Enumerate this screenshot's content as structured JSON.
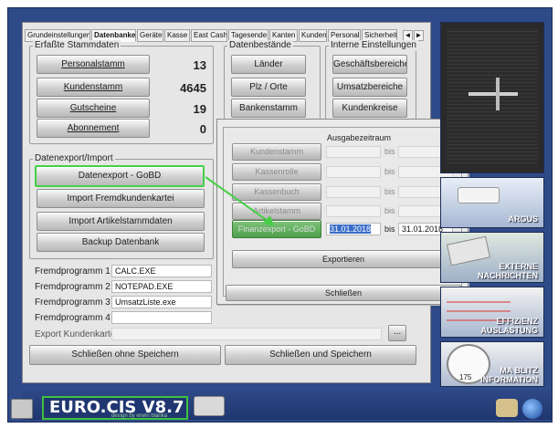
{
  "tabs": [
    "Grundeinstellungen",
    "Datenbanken",
    "Geräte",
    "Kasse",
    "East Cash",
    "Tagesende",
    "Kanten",
    "Kunden",
    "Personal",
    "Sicherheit"
  ],
  "tab_arrows": [
    "◄",
    "►"
  ],
  "stammdaten": {
    "title": "Erfaßte Stammdaten",
    "rows": [
      {
        "label": "Personalstamm",
        "count": "13"
      },
      {
        "label": "Kundenstamm",
        "count": "4645"
      },
      {
        "label": "Gutscheine",
        "count": "19"
      },
      {
        "label": "Abonnement",
        "count": "0"
      }
    ]
  },
  "datenbestand": {
    "title": "Datenbestände",
    "buttons": [
      "Länder",
      "Plz / Orte",
      "Bankenstamm"
    ]
  },
  "intern": {
    "title": "Interne Einstellungen",
    "buttons": [
      "Geschäftsbereiche",
      "Umsatzbereiche",
      "Kundenkreise"
    ]
  },
  "export": {
    "title": "Datenexport/Import",
    "buttons": [
      "Datenexport - GoBD",
      "Import Fremdkundenkartei",
      "Import Artikelstammdaten",
      "Backup Datenbank"
    ]
  },
  "fremd": [
    {
      "label": "Fremdprogramm 1",
      "value": "CALC.EXE"
    },
    {
      "label": "Fremdprogramm 2",
      "value": "NOTEPAD.EXE"
    },
    {
      "label": "Fremdprogramm 3",
      "value": "UmsatzListe.exe"
    },
    {
      "label": "Fremdprogramm 4",
      "value": ""
    }
  ],
  "export_kundenkartei": {
    "label": "Export Kundenkartei",
    "value": "",
    "browse": "..."
  },
  "footer_buttons": {
    "close_no_save": "Schließen ohne Speichern",
    "close_save": "Schließen und Speichern"
  },
  "modal": {
    "period_label": "Ausgabezeitraum",
    "rows": [
      {
        "label": "Kundenstamm",
        "from": "",
        "to_label": "bis",
        "to": ""
      },
      {
        "label": "Kassenrolle",
        "from": "",
        "to_label": "bis",
        "to": ""
      },
      {
        "label": "Kassenbuch",
        "from": "",
        "to_label": "bis",
        "to": ""
      },
      {
        "label": "Artikelstamm",
        "from": "",
        "to_label": "bis",
        "to": ""
      },
      {
        "label": "Finanzexport - GoBD",
        "from": "31.01.2018",
        "to_label": "bis",
        "to": "31.01.2018"
      }
    ],
    "export_button": "Exportieren",
    "close_button": "Schließen"
  },
  "side_panels": {
    "argus": "ARGUS",
    "externe": [
      "EXTERNE",
      "NACHRICHTEN"
    ],
    "effizienz": [
      "EFFIZIENZ",
      "AUSLASTUNG"
    ],
    "blitz": [
      "MA BLITZ",
      "INFORMATION"
    ],
    "gauge_value": "175"
  },
  "logo": {
    "name": "EURO.CIS V8.7",
    "tagline": "design by erwin blanka"
  },
  "colors": {
    "highlight": "#46d046",
    "frame": "#2f4a88"
  }
}
